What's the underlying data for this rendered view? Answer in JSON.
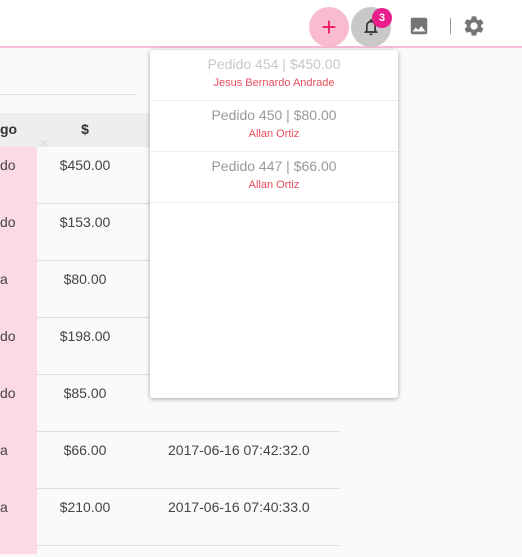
{
  "toolbar": {
    "add_label": "+",
    "notification_count": "3",
    "icons": [
      "plus-icon",
      "bell-icon",
      "image-icon",
      "gear-icon"
    ],
    "colors": {
      "accent_pink": "#e91e63",
      "badge": "#e91e8c",
      "topbar_border": "#f8bbd9"
    }
  },
  "table": {
    "headers": {
      "col1": "go",
      "col2": "$"
    },
    "rows": [
      {
        "status": "do",
        "amount": "$450.00",
        "date": ""
      },
      {
        "status": "do",
        "amount": "$153.00",
        "date": ""
      },
      {
        "status": "a",
        "amount": "$80.00",
        "date": ""
      },
      {
        "status": "do",
        "amount": "$198.00",
        "date": ""
      },
      {
        "status": "do",
        "amount": "$85.00",
        "date": ""
      },
      {
        "status": "a",
        "amount": "$66.00",
        "date": "2017-06-16 07:42:32.0"
      },
      {
        "status": "a",
        "amount": "$210.00",
        "date": "2017-06-16 07:40:33.0"
      }
    ]
  },
  "notifications": [
    {
      "title": "Pedido 454 | $450.00",
      "name": "Jesus Bernardo Andrade"
    },
    {
      "title": "Pedido 450 | $80.00",
      "name": "Allan Ortiz"
    },
    {
      "title": "Pedido 447 | $66.00",
      "name": "Allan Ortiz"
    }
  ]
}
